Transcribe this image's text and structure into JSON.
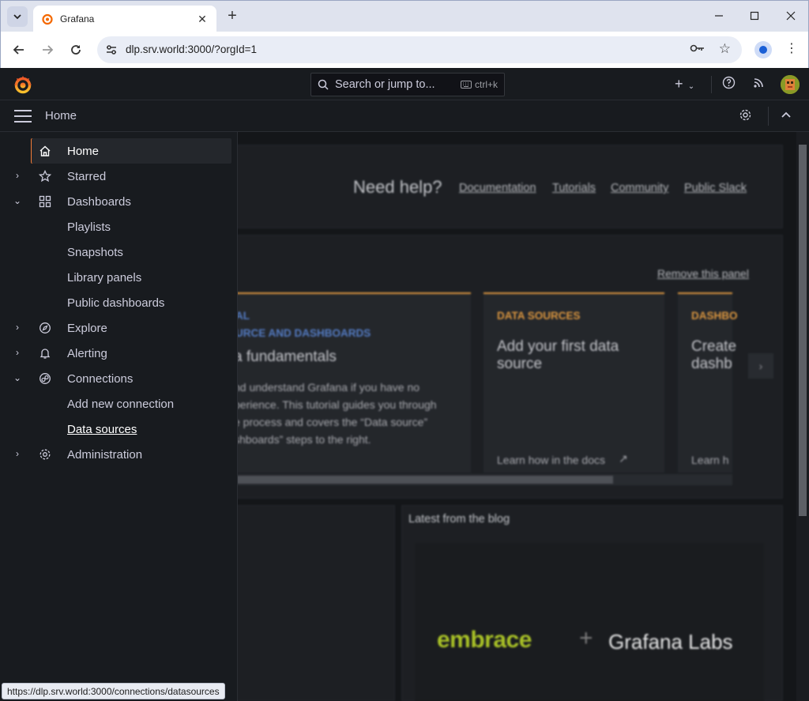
{
  "browser": {
    "tab_title": "Grafana",
    "url": "dlp.srv.world:3000/?orgId=1",
    "status_url": "https://dlp.srv.world:3000/connections/datasources"
  },
  "topbar": {
    "search_placeholder": "Search or jump to...",
    "shortcut": "ctrl+k"
  },
  "subbar": {
    "breadcrumb": "Home"
  },
  "sidebar": {
    "items": [
      {
        "label": "Home",
        "icon": "home-icon"
      },
      {
        "label": "Starred",
        "icon": "star-icon"
      },
      {
        "label": "Dashboards",
        "icon": "apps-icon"
      },
      {
        "label": "Playlists"
      },
      {
        "label": "Snapshots"
      },
      {
        "label": "Library panels"
      },
      {
        "label": "Public dashboards"
      },
      {
        "label": "Explore",
        "icon": "compass-icon"
      },
      {
        "label": "Alerting",
        "icon": "bell-icon"
      },
      {
        "label": "Connections",
        "icon": "link-icon"
      },
      {
        "label": "Add new connection"
      },
      {
        "label": "Data sources"
      },
      {
        "label": "Administration",
        "icon": "cog-icon"
      }
    ]
  },
  "main": {
    "help_title": "Need help?",
    "help_links": [
      "Documentation",
      "Tutorials",
      "Community",
      "Public Slack"
    ],
    "remove_panel": "Remove this panel",
    "card1": {
      "kicker1": "AL",
      "kicker2": "URCE AND DASHBOARDS",
      "title": "a fundamentals",
      "body": [
        "nd understand Grafana if you have no",
        "perience. This tutorial guides you through",
        "e process and covers the “Data source”",
        "shboards” steps to the right."
      ]
    },
    "card2": {
      "kicker": "DATA SOURCES",
      "title1": "Add your first data",
      "title2": "source",
      "footer": "Learn how in the docs"
    },
    "card3": {
      "kicker": "DASHBO",
      "title1": "Create",
      "title2": "dashb",
      "footer": "Learn h"
    },
    "blog_title": "Latest from the blog",
    "blog_image": {
      "left": "embrace",
      "sep": "+",
      "right": "Grafana Labs"
    }
  },
  "colors": {
    "accent": "#f57d38",
    "background": "#181b1f",
    "panel": "#1e2125",
    "card_border": "#f2a544"
  }
}
